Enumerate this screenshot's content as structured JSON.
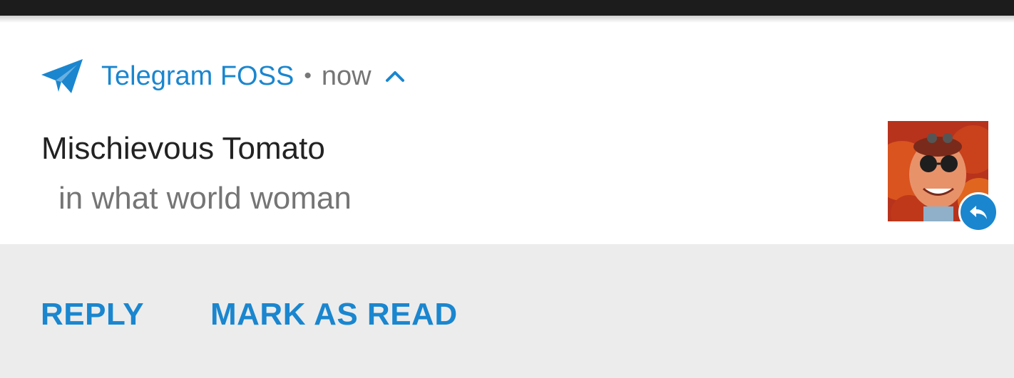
{
  "notification": {
    "app_name": "Telegram FOSS",
    "separator": "•",
    "time": "now",
    "title": "Mischievous Tomato",
    "message": "in what world woman",
    "app_icon": "telegram-plane-icon",
    "expand_icon": "chevron-up-icon",
    "badge_icon": "reply-arrow-icon"
  },
  "actions": {
    "reply_label": "REPLY",
    "mark_read_label": "MARK AS READ"
  },
  "colors": {
    "accent": "#1a86cf",
    "secondary_text": "#757575",
    "primary_text": "#222222",
    "actions_bg": "#ececec"
  }
}
